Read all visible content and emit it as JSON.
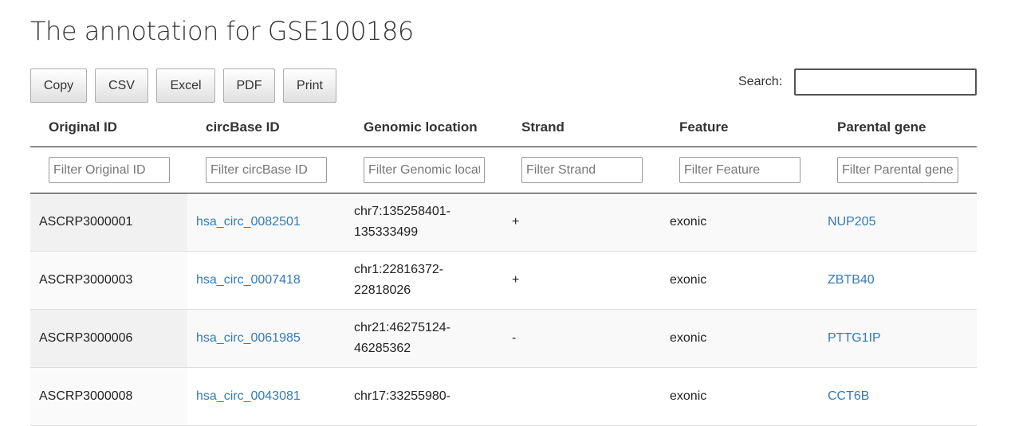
{
  "page": {
    "title": "The annotation for GSE100186"
  },
  "toolbar": {
    "buttons": [
      "Copy",
      "CSV",
      "Excel",
      "PDF",
      "Print"
    ]
  },
  "search": {
    "label": "Search:",
    "value": "",
    "placeholder": ""
  },
  "table": {
    "columns": [
      "Original ID",
      "circBase ID",
      "Genomic location",
      "Strand",
      "Feature",
      "Parental gene"
    ],
    "filters": [
      "Filter Original ID",
      "Filter circBase ID",
      "Filter Genomic location",
      "Filter Strand",
      "Filter Feature",
      "Filter Parental gene"
    ],
    "rows": [
      {
        "original_id": "ASCRP3000001",
        "circbase_id": "hsa_circ_0082501",
        "location_line1": "chr7:135258401-",
        "location_line2": "135333499",
        "strand": "+",
        "feature": "exonic",
        "parental_gene": "NUP205"
      },
      {
        "original_id": "ASCRP3000003",
        "circbase_id": "hsa_circ_0007418",
        "location_line1": "chr1:22816372-",
        "location_line2": "22818026",
        "strand": "+",
        "feature": "exonic",
        "parental_gene": "ZBTB40"
      },
      {
        "original_id": "ASCRP3000006",
        "circbase_id": "hsa_circ_0061985",
        "location_line1": "chr21:46275124-",
        "location_line2": "46285362",
        "strand": "-",
        "feature": "exonic",
        "parental_gene": "PTTG1IP"
      },
      {
        "original_id": "ASCRP3000008",
        "circbase_id": "hsa_circ_0043081",
        "location_line1": "chr17:33255980-",
        "location_line2": "",
        "strand": "",
        "feature": "exonic",
        "parental_gene": "CCT6B"
      }
    ]
  },
  "colors": {
    "link": "#337ab7",
    "title": "#333333"
  }
}
